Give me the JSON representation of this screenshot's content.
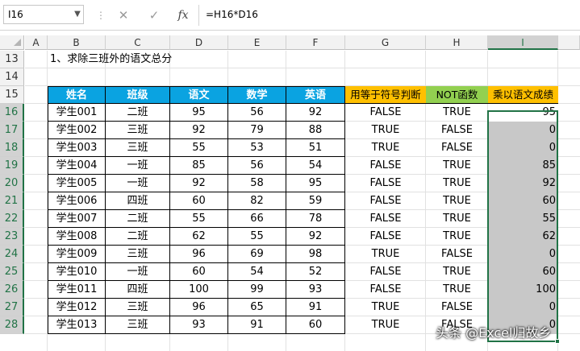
{
  "formula_bar": {
    "cell_ref": "I16",
    "formula": "=H16*D16",
    "cancel_icon": "✕",
    "enter_icon": "✓",
    "fx_label": "fx",
    "separator": "⋮"
  },
  "columns": [
    "A",
    "B",
    "C",
    "D",
    "E",
    "F",
    "G",
    "H",
    "I"
  ],
  "selected_column": "I",
  "rows": [
    "13",
    "14",
    "15",
    "16",
    "17",
    "18",
    "19",
    "20",
    "21",
    "22",
    "23",
    "24",
    "25",
    "26",
    "27",
    "28"
  ],
  "title_text": "1、求除三班外的语文总分",
  "table": {
    "headers": [
      "姓名",
      "班级",
      "语文",
      "数学",
      "英语"
    ],
    "extra_headers": [
      "用等于符号判断",
      "NOT函数",
      "乘以语文成绩"
    ],
    "records": [
      [
        "学生001",
        "二班",
        "95",
        "56",
        "92",
        "FALSE",
        "TRUE",
        "95"
      ],
      [
        "学生002",
        "三班",
        "92",
        "79",
        "88",
        "TRUE",
        "FALSE",
        "0"
      ],
      [
        "学生003",
        "三班",
        "55",
        "53",
        "51",
        "TRUE",
        "FALSE",
        "0"
      ],
      [
        "学生004",
        "一班",
        "85",
        "56",
        "54",
        "FALSE",
        "TRUE",
        "85"
      ],
      [
        "学生005",
        "一班",
        "92",
        "58",
        "95",
        "FALSE",
        "TRUE",
        "92"
      ],
      [
        "学生006",
        "四班",
        "60",
        "82",
        "59",
        "FALSE",
        "TRUE",
        "60"
      ],
      [
        "学生007",
        "二班",
        "55",
        "66",
        "78",
        "FALSE",
        "TRUE",
        "55"
      ],
      [
        "学生008",
        "二班",
        "62",
        "55",
        "92",
        "FALSE",
        "TRUE",
        "62"
      ],
      [
        "学生009",
        "三班",
        "96",
        "69",
        "98",
        "TRUE",
        "FALSE",
        "0"
      ],
      [
        "学生010",
        "一班",
        "60",
        "54",
        "52",
        "FALSE",
        "TRUE",
        "60"
      ],
      [
        "学生011",
        "四班",
        "100",
        "99",
        "93",
        "FALSE",
        "TRUE",
        "100"
      ],
      [
        "学生012",
        "三班",
        "96",
        "65",
        "91",
        "TRUE",
        "FALSE",
        "0"
      ],
      [
        "学生013",
        "三班",
        "93",
        "91",
        "60",
        "TRUE",
        "FALSE",
        "0"
      ]
    ]
  },
  "watermark": "头条 @Excel归故乡",
  "colors": {
    "header_blue": "#0aa3e1",
    "header_orange": "#ffc000",
    "header_green": "#92d050",
    "selection": "#217346"
  }
}
